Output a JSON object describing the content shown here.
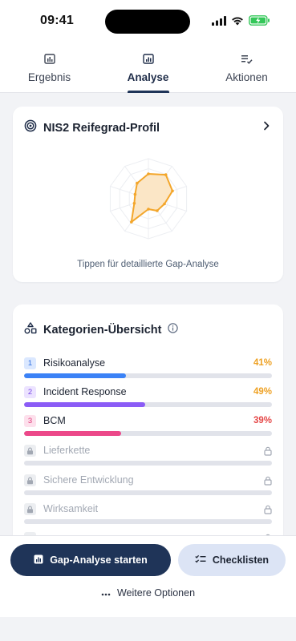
{
  "status": {
    "time": "09:41"
  },
  "tabs": [
    {
      "label": "Ergebnis",
      "icon": "bar-chart-icon",
      "active": false
    },
    {
      "label": "Analyse",
      "icon": "report-chart-icon",
      "active": true
    },
    {
      "label": "Aktionen",
      "icon": "checklist-icon",
      "active": false
    }
  ],
  "radar": {
    "title": "NIS2 Reifegrad-Profil",
    "hint": "Tippen für detaillierte Gap-Analyse",
    "accent": "#f3a62b",
    "fill": "#fbe6c6",
    "values": [
      0.62,
      0.74,
      0.63,
      0.42,
      0.37,
      0.26,
      0.72,
      0.37,
      0.35,
      0.48
    ]
  },
  "categories": {
    "title": "Kategorien-Übersicht",
    "items": [
      {
        "num": "1",
        "label": "Risikoanalyse",
        "pct": "41%",
        "value": 0.41,
        "color": "#3b82f6",
        "badge_bg": "#dbe8ff",
        "badge_fg": "#2f6fe0",
        "pct_color": "#eea123"
      },
      {
        "num": "2",
        "label": "Incident Response",
        "pct": "49%",
        "value": 0.49,
        "color": "#8b5cf6",
        "badge_bg": "#ece3ff",
        "badge_fg": "#7a4be6",
        "pct_color": "#eea123"
      },
      {
        "num": "3",
        "label": "BCM",
        "pct": "39%",
        "value": 0.39,
        "color": "#ec4889",
        "badge_bg": "#fde0ec",
        "badge_fg": "#e0407d",
        "pct_color": "#e54848"
      }
    ],
    "locked": [
      {
        "label": "Lieferkette"
      },
      {
        "label": "Sichere Entwicklung"
      },
      {
        "label": "Wirksamkeit"
      }
    ]
  },
  "actions": {
    "primary": "Gap-Analyse starten",
    "secondary": "Checklisten",
    "more": "Weitere Optionen"
  }
}
